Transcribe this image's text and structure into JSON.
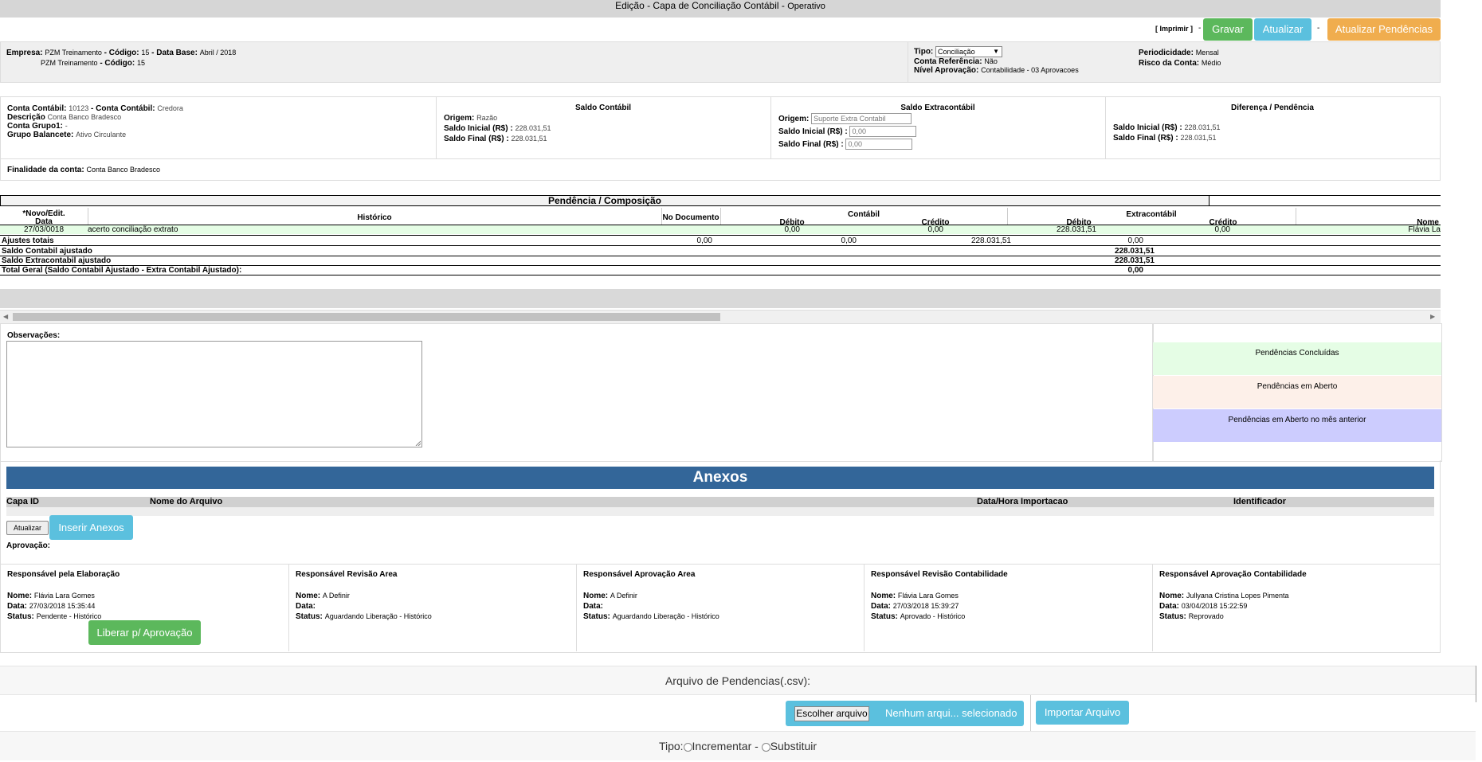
{
  "title": {
    "main": "Edição - Capa de Conciliação Contábil",
    "sub": "Operativo",
    "sep": " - "
  },
  "toolbar": {
    "print_label": "[ Imprimir ]",
    "dash": "-",
    "save_label": "Gravar",
    "refresh_label": "Atualizar",
    "update_pending_label": "Atualizar Pendências"
  },
  "info": {
    "empresa_label": "Empresa:",
    "empresa_value": "PZM Treinamento",
    "codigo_label": "- Código:",
    "codigo_value": "15",
    "database_label": "- Data Base:",
    "database_value": "Abril / 2018",
    "empresa2_value": "PZM Treinamento",
    "codigo2_label": "- Código:",
    "codigo2_value": "15",
    "tipo_label": "Tipo:",
    "tipo_value": "Conciliação",
    "conta_ref_label": "Conta Referência:",
    "conta_ref_value": "Não",
    "nivel_label": "Nível Aprovação:",
    "nivel_value": "Contabilidade - 03 Aprovacoes",
    "periodicidade_label": "Periodicidade:",
    "periodicidade_value": "Mensal",
    "risco_label": "Risco da Conta:",
    "risco_value": "Médio"
  },
  "account": {
    "conta_label": "Conta Contábil:",
    "conta_value": "10123",
    "conta2_label": "- Conta Contábil:",
    "conta2_value": "Credora",
    "descricao_label": "Descrição",
    "descricao_value": "Conta Banco Bradesco",
    "grupo_label": "Conta Grupo1:",
    "grupo_value": "-",
    "balancete_label": "Grupo Balancete:",
    "balancete_value": "Ativo Circulante",
    "finalidade_label": "Finalidade da conta:",
    "finalidade_value": "Conta Banco Bradesco"
  },
  "saldo_contabil": {
    "title": "Saldo Contábil",
    "origem_label": "Origem:",
    "origem_value": "Razão",
    "inicial_label": "Saldo Inicial (R$) :",
    "inicial_value": "228.031,51",
    "final_label": "Saldo Final (R$) :",
    "final_value": "228.031,51"
  },
  "saldo_extra": {
    "title": "Saldo Extracontábil",
    "origem_label": "Origem:",
    "origem_placeholder": "Suporte Extra Contabil",
    "inicial_label": "Saldo Inicial (R$) :",
    "inicial_value": "0,00",
    "final_label": "Saldo Final (R$) :",
    "final_value": "0,00"
  },
  "diferenca": {
    "title": "Diferença / Pendência",
    "inicial_label": "Saldo Inicial (R$) :",
    "inicial_value": "228.031,51",
    "final_label": "Saldo Final (R$) :",
    "final_value": "228.031,51"
  },
  "grid": {
    "title": "Pendência / Composição",
    "col_novo": "*Novo/Edit.",
    "col_data": "Data",
    "col_historico": "Histórico",
    "col_documento": "No Documento",
    "col_contabil": "Contábil",
    "col_extracontabil": "Extracontábil",
    "col_debito": "Débito",
    "col_credito": "Crédito",
    "col_debito2": "Débito",
    "col_credito2": "Crédito",
    "col_nome": "Nome",
    "row": {
      "data": "27/03/0018",
      "historico": "acerto conciliação extrato",
      "deb": "0,00",
      "cred": "0,00",
      "deb2": "228.031,51",
      "cred2": "0,00",
      "nome": "Flávia La"
    },
    "ajustes_label": "Ajustes totais",
    "ajustes": [
      "0,00",
      "0,00",
      "228.031,51",
      "0,00"
    ],
    "saldo_contabil_aj_label": "Saldo Contabil ajustado",
    "saldo_contabil_aj_value": "228.031,51",
    "saldo_extra_aj_label": "Saldo Extracontabil ajustado",
    "saldo_extra_aj_value": "228.031,51",
    "total_label": "Total Geral (Saldo Contabil Ajustado - Extra Contabil Ajustado):",
    "total_value": "0,00"
  },
  "obs": {
    "label": "Observações:"
  },
  "legend": {
    "concluidas": "Pendências Concluídas",
    "aberto": "Pendências em Aberto",
    "anterior": "Pendências em Aberto no mês anterior",
    "c1": "#e5fde5",
    "c2": "#fdf0e9",
    "c3": "#ccccfe"
  },
  "anexos": {
    "title": "Anexos",
    "col_capa": "Capa ID",
    "col_nome": "Nome do Arquivo",
    "col_data": "Data/Hora Importacao",
    "col_ident": "Identificador",
    "refresh_label": "Atualizar",
    "insert_label": "Inserir Anexos",
    "aprovacao_label": "Aprovação:"
  },
  "responsaveis": [
    {
      "title": "Responsável pela Elaboração",
      "nome": "Flávia Lara Gomes",
      "data": "27/03/2018 15:35:44",
      "status": "Pendente - Histórico"
    },
    {
      "title": "Responsável Revisão Area",
      "nome": "A Definir",
      "data": "",
      "status": "Aguardando Liberação - Histórico"
    },
    {
      "title": "Responsável Aprovação Area",
      "nome": "A Definir",
      "data": "",
      "status": "Aguardando Liberação - Histórico"
    },
    {
      "title": "Responsável Revisão Contabilidade",
      "nome": "Flávia Lara Gomes",
      "data": "27/03/2018 15:39:27",
      "status": "Aprovado - Histórico"
    },
    {
      "title": "Responsável Aprovação Contabilidade",
      "nome": "Jullyana Cristina Lopes Pimenta",
      "data": "03/04/2018 15:22:59",
      "status": "Reprovado"
    }
  ],
  "labels": {
    "nome": "Nome:",
    "data": "Data:",
    "status": "Status:"
  },
  "liberar_label": "Liberar p/ Aprovação",
  "upload": {
    "title": "Arquivo de Pendencias(.csv):",
    "choose_label": "Escolher arquivo",
    "no_file": "Nenhum arqui... selecionado",
    "import_label": "Importar Arquivo",
    "tipo_label": "Tipo:",
    "opt1": "Incrementar -",
    "opt2": "Substituir"
  },
  "scroll": {
    "left_arrow": "◀",
    "right_arrow": "▶"
  }
}
